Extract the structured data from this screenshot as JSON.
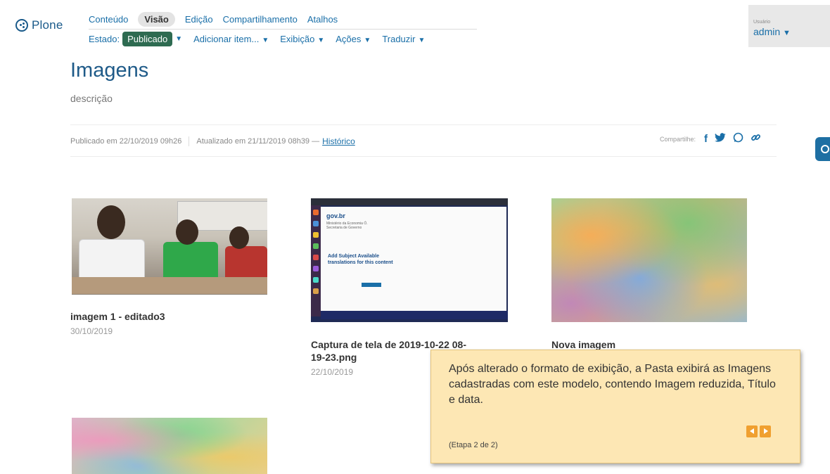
{
  "brand": {
    "logo_text": "Plone"
  },
  "toolbar": {
    "tabs": [
      {
        "label": "Conteúdo"
      },
      {
        "label": "Visão",
        "active": true
      },
      {
        "label": "Edição"
      },
      {
        "label": "Compartilhamento"
      },
      {
        "label": "Atalhos"
      }
    ],
    "estado_label": "Estado:",
    "estado_value": "Publicado",
    "menus": [
      {
        "label": "Adicionar item..."
      },
      {
        "label": "Exibição"
      },
      {
        "label": "Ações"
      },
      {
        "label": "Traduzir"
      }
    ]
  },
  "user": {
    "label": "Usuário",
    "name": "admin"
  },
  "page": {
    "title": "Imagens",
    "description": "descrição",
    "published": "Publicado em 22/10/2019 09h26",
    "updated": "Atualizado em 21/11/2019 08h39 —",
    "history_link": "Histórico",
    "share_label": "Compartilhe:"
  },
  "items": [
    {
      "title": "imagem 1 - editado3",
      "date": "30/10/2019"
    },
    {
      "title_line1": "Captura de tela de 2019-10-22 08-",
      "title_line2": "19-23.png",
      "date": "22/10/2019"
    },
    {
      "title": "Nova imagem"
    }
  ],
  "screenshot_text": {
    "site": "gov.br",
    "subtitle": "Ministério da Economia Ó. Secretaria de Governo",
    "modal_title": "Add Subject Available translations for this content"
  },
  "tour": {
    "text": "Após alterado o formato de exibição, a Pasta exibirá as Imagens cadastradas com este modelo, contendo Imagem reduzida, Título e data.",
    "step": "(Etapa 2 de 2)"
  },
  "colors": {
    "link": "#1a6fa8",
    "title": "#1e5a88",
    "badge": "#2e6b51",
    "tour_bg": "#fde7b4",
    "tour_button": "#f0a030"
  }
}
